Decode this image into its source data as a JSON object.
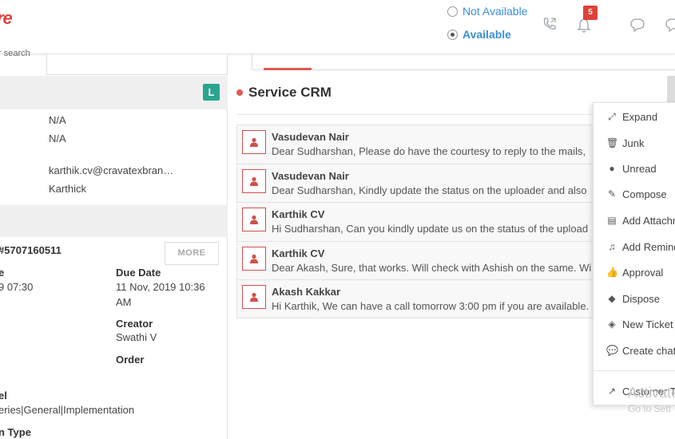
{
  "header": {
    "logo_text": "re",
    "status_options": [
      {
        "label": "Not Available",
        "checked": false
      },
      {
        "label": "Available",
        "checked": true
      }
    ],
    "notification_count": "5",
    "search_hint": "r search"
  },
  "contact": {
    "badge": "L",
    "values": [
      "N/A",
      "N/A",
      "karthik.cv@cravatexbran…",
      "Karthick"
    ]
  },
  "ticket": {
    "id": "#5707160511",
    "more_label": "MORE",
    "created_label": "e",
    "created_value": "9 07:30",
    "due_label": "Due Date",
    "due_value_1": "11 Nov, 2019 10:36",
    "due_value_2": "AM",
    "creator_label": "Creator",
    "creator_value": "Swathi V",
    "order_label": "Order",
    "level_label": "el",
    "level_value": "eries|General|Implementation",
    "type_label": "n Type"
  },
  "main": {
    "title": "Service CRM",
    "messages": [
      {
        "name": "Vasudevan Nair",
        "preview": "Dear Sudharshan, Please do have the courtesy to reply to the mails,"
      },
      {
        "name": "Vasudevan Nair",
        "preview": "Dear Sudharshan,  Kindly update the status on the uploader and also"
      },
      {
        "name": "Karthik CV",
        "preview": "Hi Sudharshan, Can you kindly update us on the status of the upload"
      },
      {
        "name": "Karthik CV",
        "preview": "Dear Akash, Sure, that works. Will check with Ashish on the same. Wi"
      },
      {
        "name": "Akash Kakkar",
        "preview": "Hi Karthik, We can have a call tomorrow 3:00 pm if you are available."
      }
    ]
  },
  "context_menu": {
    "items": [
      {
        "label": "Expand",
        "icon": "expand-icon"
      },
      {
        "label": "Junk",
        "icon": "trash-icon"
      },
      {
        "label": "Unread",
        "icon": "dot-icon"
      },
      {
        "label": "Compose",
        "icon": "edit-icon"
      },
      {
        "label": "Add Attachm",
        "icon": "file-icon"
      },
      {
        "label": "Add Remind",
        "icon": "bell-icon"
      },
      {
        "label": "Approval",
        "icon": "thumbs-up-icon"
      },
      {
        "label": "Dispose",
        "icon": "tag-icon"
      },
      {
        "label": "New Ticket",
        "icon": "ticket-icon"
      },
      {
        "label": "Create chat",
        "icon": "chat-icon"
      }
    ],
    "footer_label": "Customer T"
  },
  "watermark": {
    "line1": "Activate",
    "line2": "Go to Sett"
  }
}
